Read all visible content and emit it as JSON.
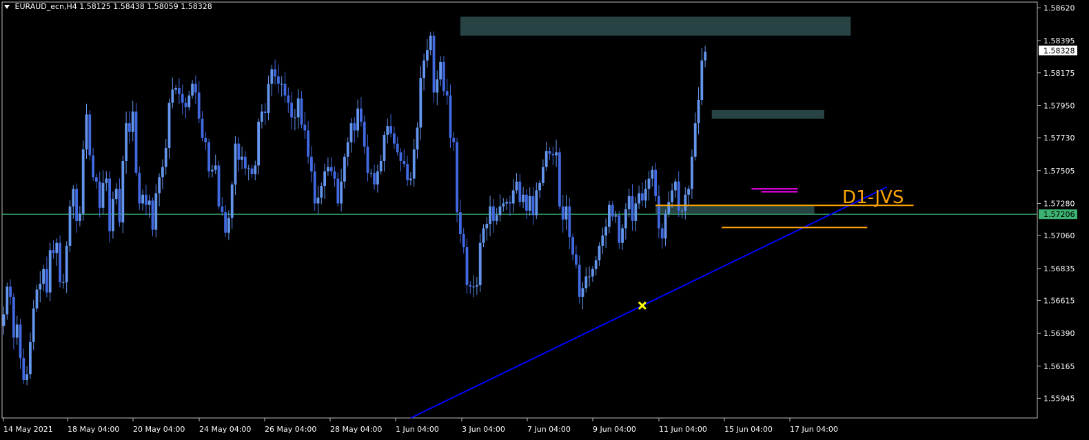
{
  "header": {
    "title": "EURAUD_ecn,H4  1.58125 1.58438 1.58059 1.58328"
  },
  "colors": {
    "background": "#000000",
    "frame": "#c0c0c0",
    "bull": "#6495ED",
    "bear": "#4169E1",
    "zone": "#2F4F4F",
    "green_line": "#3CB371",
    "trendline": "#0000FF",
    "orange": "#FFA500",
    "magenta": "#FF00FF",
    "marker": "#FFFF00",
    "price_tag": "#FFFFFF",
    "green_tag": "#3CB371"
  },
  "chart_data": {
    "type": "candlestick",
    "symbol": "EURAUD_ecn",
    "timeframe": "H4",
    "ohlc_latest": {
      "open": 1.58125,
      "high": 1.58438,
      "low": 1.58059,
      "close": 1.58328
    },
    "ylim": [
      1.5581,
      1.5866
    ],
    "y_ticks": [
      "1.58620",
      "1.58395",
      "1.58175",
      "1.57950",
      "1.57730",
      "1.57505",
      "1.57280",
      "1.57060",
      "1.56835",
      "1.56615",
      "1.56390",
      "1.56165",
      "1.55945"
    ],
    "x_ticks": [
      "14 May 2021",
      "18 May 04:00",
      "20 May 04:00",
      "24 May 04:00",
      "26 May 04:00",
      "28 May 04:00",
      "1 Jun 04:00",
      "3 Jun 04:00",
      "7 Jun 04:00",
      "9 Jun 04:00",
      "11 Jun 04:00",
      "15 Jun 04:00",
      "17 Jun 04:00"
    ],
    "price_tags": {
      "current": "1.58328",
      "level": "1.57206"
    },
    "horizontal_level": 1.57206,
    "trendline": {
      "from_bar": 123,
      "from_price": 1.5581,
      "to_bar": 267,
      "to_price": 1.57393
    },
    "zones": [
      {
        "from_bar": 138,
        "to_bar": 256,
        "high": 1.5856,
        "low": 1.5843
      },
      {
        "from_bar": 214,
        "to_bar": 248,
        "high": 1.5792,
        "low": 1.5786
      },
      {
        "from_bar": 197,
        "to_bar": 245,
        "high": 1.5727,
        "low": 1.5721
      }
    ],
    "levels": [
      {
        "label": "D1-JVS",
        "from_bar": 197,
        "to_bar": 275,
        "price": 1.57267,
        "color": "orange"
      },
      {
        "from_bar": 217,
        "to_bar": 261,
        "price": 1.57115,
        "color": "orange"
      },
      {
        "from_bar": 226,
        "to_bar": 240,
        "price": 1.5738,
        "color": "magenta"
      },
      {
        "from_bar": 229,
        "to_bar": 240,
        "price": 1.5736,
        "color": "magenta"
      }
    ],
    "annotation": "D1-JVS",
    "marker": {
      "bar": 193,
      "price": 1.5658,
      "symbol": "x"
    },
    "series": [
      {
        "bar_start": 0,
        "closes": [
          1.5652,
          1.5671,
          1.5664,
          1.5636,
          1.5645,
          1.5622,
          1.5607,
          1.5611,
          1.5633,
          1.5656,
          1.5669,
          1.5673,
          1.5683,
          1.5667,
          1.5696,
          1.5694,
          1.5701,
          1.5674,
          1.5674,
          1.5699,
          1.5726,
          1.5738,
          1.5716,
          1.5721,
          1.5765,
          1.5789,
          1.5761,
          1.5746,
          1.5743,
          1.5725,
          1.5742,
          1.5745,
          1.5709,
          1.5731,
          1.5738,
          1.5715,
          1.5757,
          1.5783,
          1.5777,
          1.5791,
          1.5749,
          1.5728,
          1.5734,
          1.5727,
          1.573,
          1.571,
          1.5735,
          1.5746,
          1.5753,
          1.5766,
          1.5797,
          1.5806,
          1.5807,
          1.5803,
          1.5797,
          1.5794,
          1.5802,
          1.581,
          1.5804,
          1.5786,
          1.5773,
          1.577,
          1.575,
          1.5751,
          1.5754,
          1.5726,
          1.5722,
          1.5708,
          1.5718,
          1.5741,
          1.5769,
          1.5758,
          1.576,
          1.5752,
          1.5752,
          1.5748,
          1.5754,
          1.5784,
          1.5791,
          1.579,
          1.581,
          1.582,
          1.5815,
          1.581,
          1.581,
          1.5802,
          1.5797,
          1.5787,
          1.5787,
          1.58,
          1.5782,
          1.5778,
          1.576,
          1.575,
          1.5728,
          1.5732,
          1.574,
          1.575,
          1.5753,
          1.575,
          1.5745,
          1.5728,
          1.5743,
          1.576,
          1.577,
          1.5783,
          1.5778,
          1.5793,
          1.5784,
          1.5767,
          1.5749,
          1.5749,
          1.5741,
          1.575,
          1.5757,
          1.5775,
          1.5781,
          1.5776,
          1.5769,
          1.5763,
          1.5757,
          1.5755,
          1.5744,
          1.5745,
          1.5765,
          1.578,
          1.5814,
          1.5826,
          1.5833,
          1.5843,
          1.5804,
          1.5813,
          1.5825,
          1.5805,
          1.5802,
          1.5773,
          1.577,
          1.5722,
          1.5707,
          1.5698,
          1.5672,
          1.5671,
          1.5671,
          1.5672,
          1.5701,
          1.5711,
          1.5714,
          1.5726,
          1.5716,
          1.572,
          1.5726,
          1.5728,
          1.5729,
          1.5728,
          1.5737,
          1.5743,
          1.5729,
          1.5734,
          1.5723,
          1.5733,
          1.572,
          1.5737,
          1.5742,
          1.5753,
          1.5764,
          1.5762,
          1.5761,
          1.5763,
          1.5726,
          1.5717,
          1.5726,
          1.5705,
          1.5693,
          1.5686,
          1.5664,
          1.567,
          1.5678,
          1.5678,
          1.5683,
          1.5689,
          1.5699,
          1.5706,
          1.5712,
          1.5727,
          1.5719,
          1.572,
          1.5701,
          1.5711,
          1.5724,
          1.5733,
          1.5716,
          1.5728,
          1.5735,
          1.573,
          1.5738,
          1.5745,
          1.5751,
          1.5733,
          1.5711,
          1.5704,
          1.5721,
          1.5729,
          1.5737,
          1.5743,
          1.5723,
          1.5723,
          1.5734,
          1.5738,
          1.576,
          1.5783,
          1.5799,
          1.5826,
          1.5832
        ]
      }
    ]
  }
}
